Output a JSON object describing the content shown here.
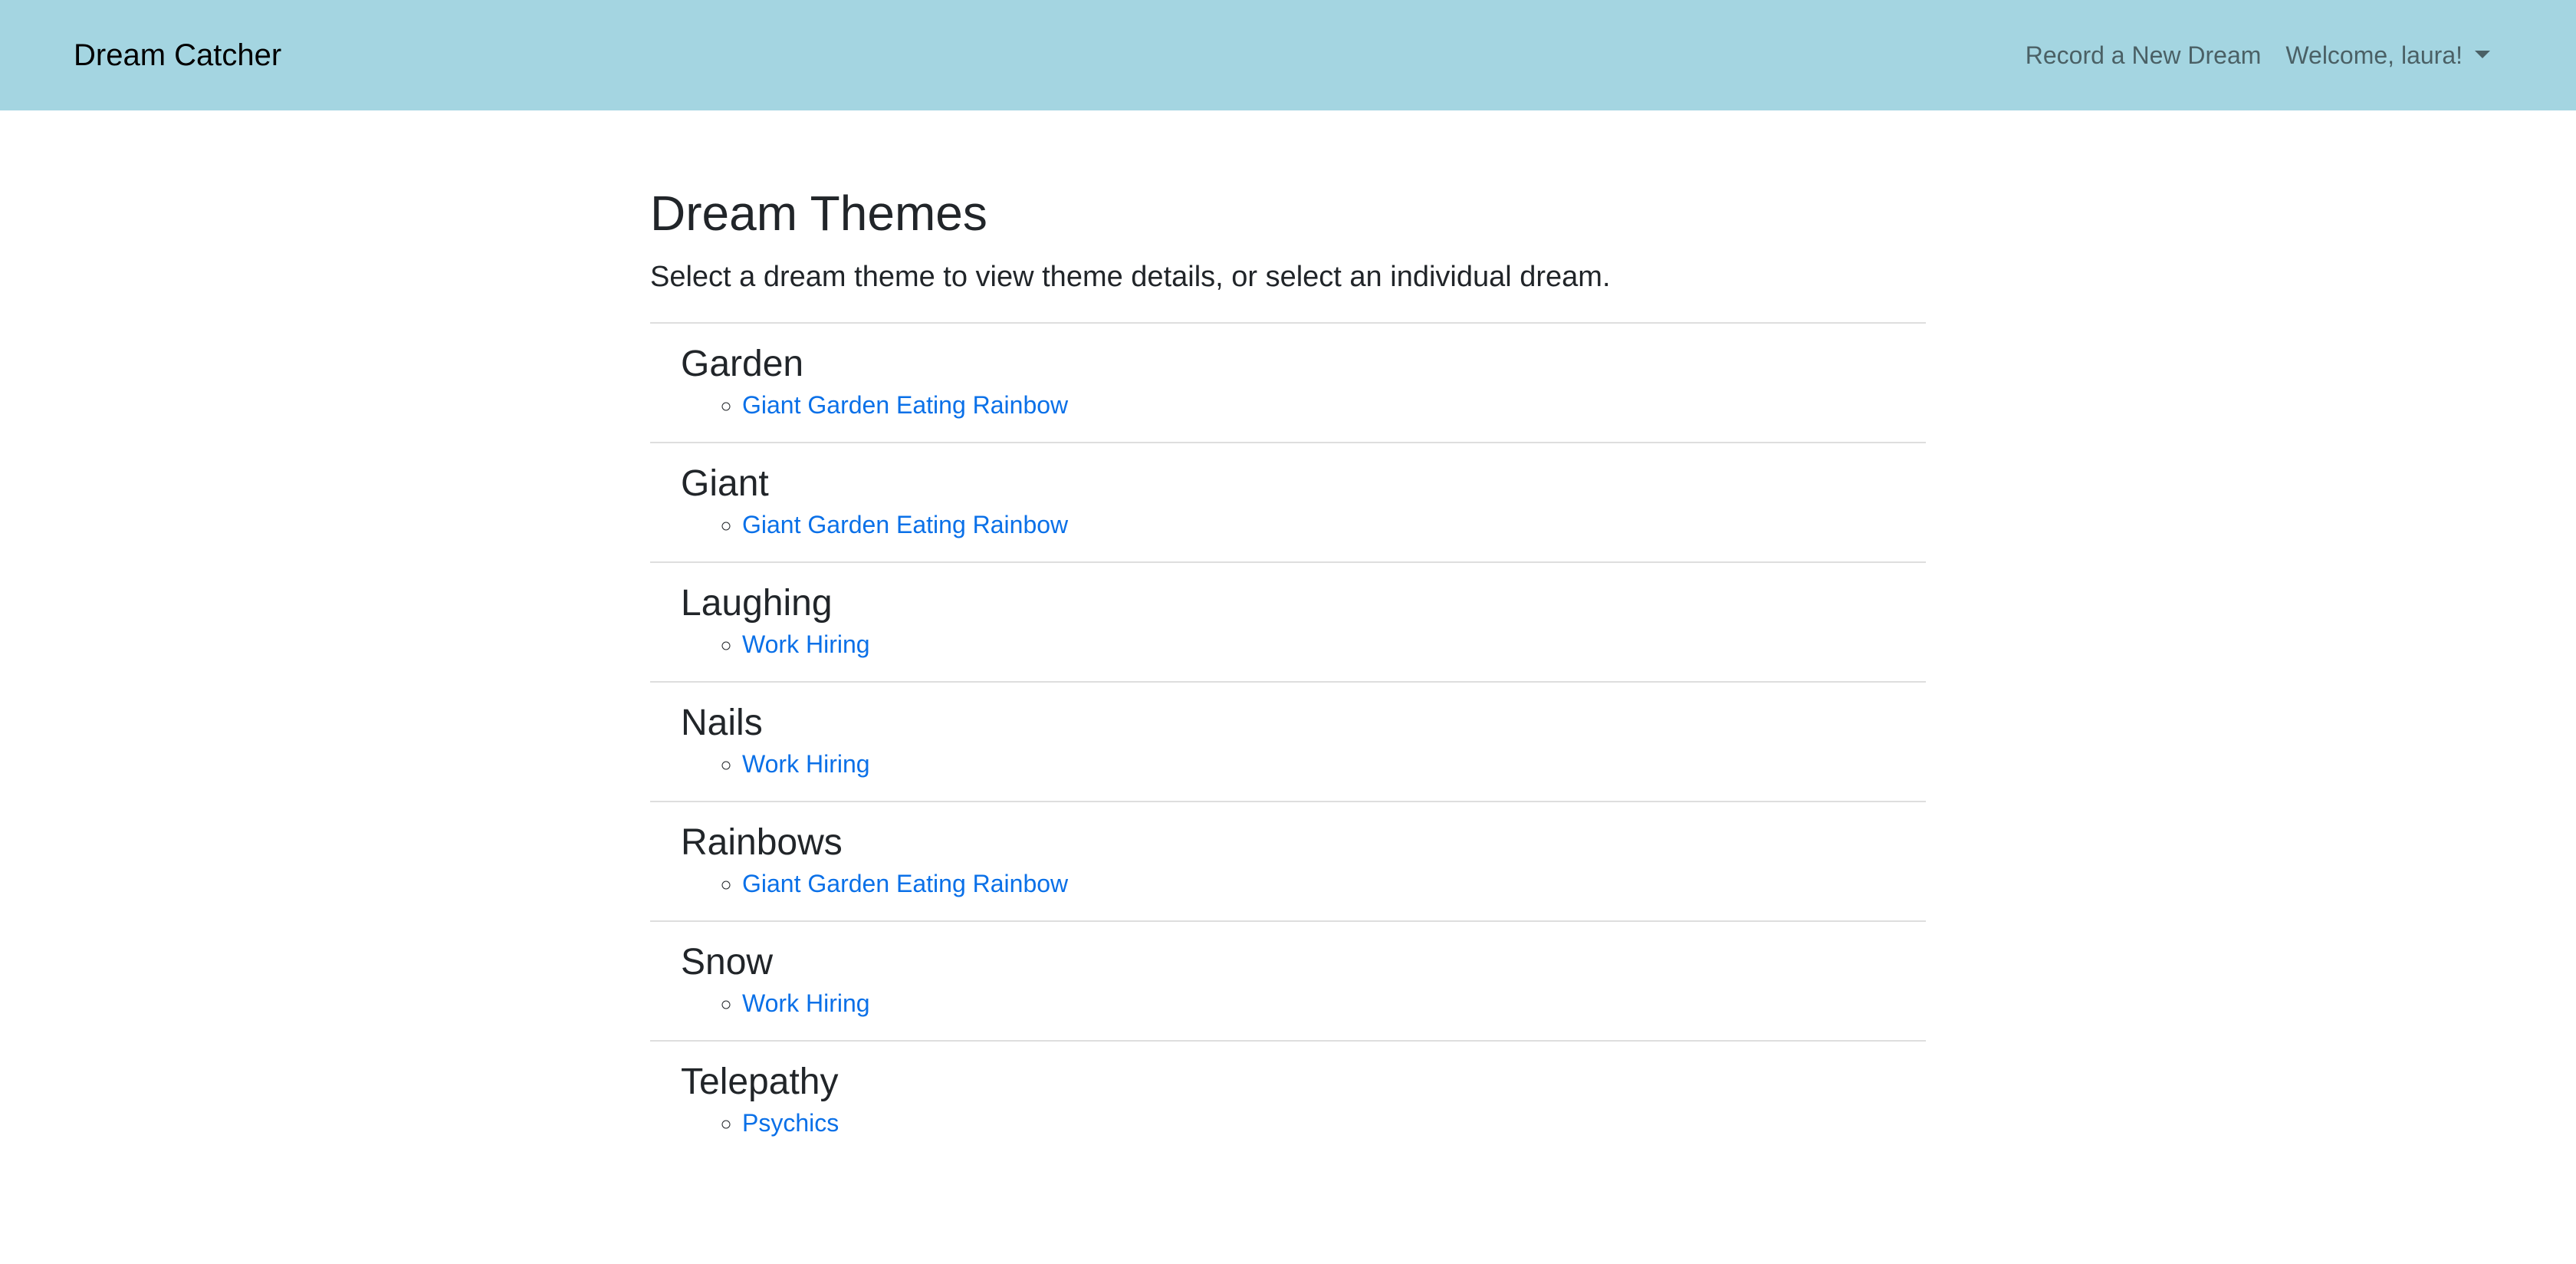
{
  "navbar": {
    "brand": "Dream Catcher",
    "record_link": "Record a New Dream",
    "welcome_label": "Welcome, laura!"
  },
  "main": {
    "title": "Dream Themes",
    "lead": "Select a dream theme to view theme details, or select an individual dream.",
    "themes": [
      {
        "name": "Garden",
        "dreams": [
          "Giant Garden Eating Rainbow"
        ]
      },
      {
        "name": "Giant",
        "dreams": [
          "Giant Garden Eating Rainbow"
        ]
      },
      {
        "name": "Laughing",
        "dreams": [
          "Work Hiring"
        ]
      },
      {
        "name": "Nails",
        "dreams": [
          "Work Hiring"
        ]
      },
      {
        "name": "Rainbows",
        "dreams": [
          "Giant Garden Eating Rainbow"
        ]
      },
      {
        "name": "Snow",
        "dreams": [
          "Work Hiring"
        ]
      },
      {
        "name": "Telepathy",
        "dreams": [
          "Psychics"
        ]
      }
    ]
  },
  "colors": {
    "navbar_bg": "#a4d5e1",
    "link": "#0a70e8",
    "text": "#212529"
  }
}
